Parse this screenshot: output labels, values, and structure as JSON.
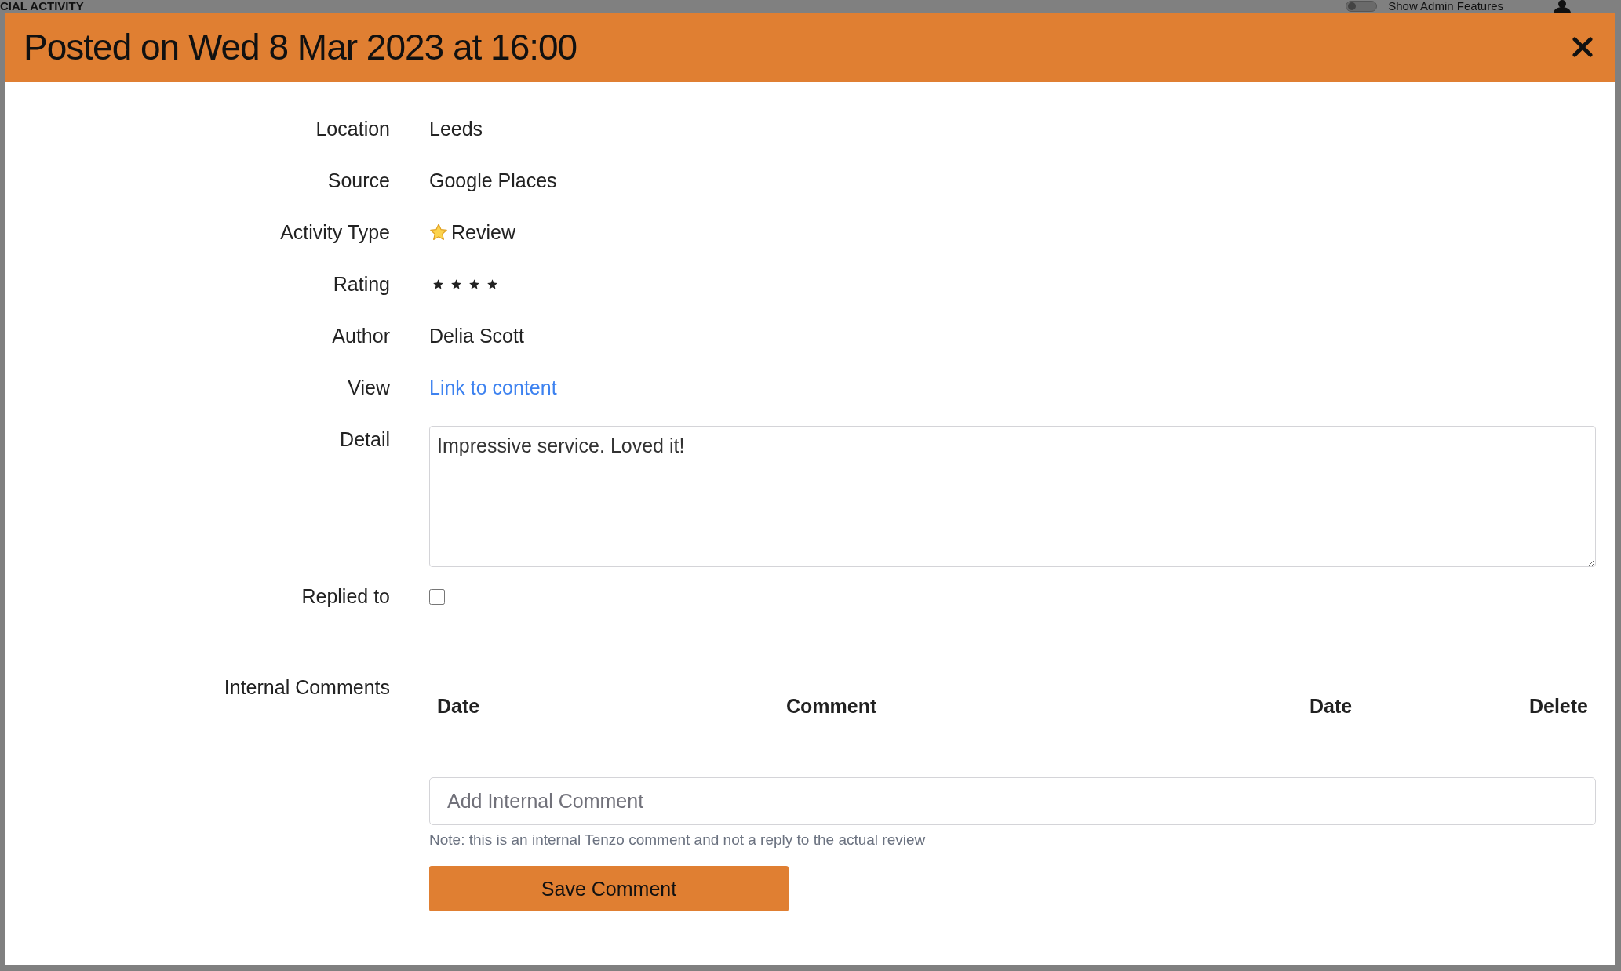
{
  "background": {
    "heading": "CIAL ACTIVITY",
    "admin_toggle": {
      "label": "Show Admin Features",
      "on": false
    }
  },
  "modal": {
    "title": "Posted on Wed 8 Mar 2023 at 16:00",
    "fields": [
      {
        "kind": "text",
        "label": "Location",
        "value": "Leeds"
      },
      {
        "kind": "text",
        "label": "Source",
        "value": "Google Places"
      },
      {
        "kind": "activity",
        "label": "Activity Type",
        "value": "Review"
      },
      {
        "kind": "rating",
        "label": "Rating",
        "stars": 4
      },
      {
        "kind": "text",
        "label": "Author",
        "value": "Delia Scott"
      },
      {
        "kind": "link",
        "label": "View",
        "value": "Link to content"
      },
      {
        "kind": "textarea",
        "label": "Detail",
        "value": "Impressive service. Loved it!"
      },
      {
        "kind": "checkbox",
        "label": "Replied to",
        "checked": false
      }
    ],
    "comments": {
      "label": "Internal Comments",
      "columns": [
        "Date",
        "Comment",
        "Date",
        "Delete"
      ],
      "input": {
        "placeholder": "Add Internal Comment"
      },
      "note": "Note: this is an internal Tenzo comment and not a reply to the actual review",
      "button": "Save Comment"
    }
  }
}
